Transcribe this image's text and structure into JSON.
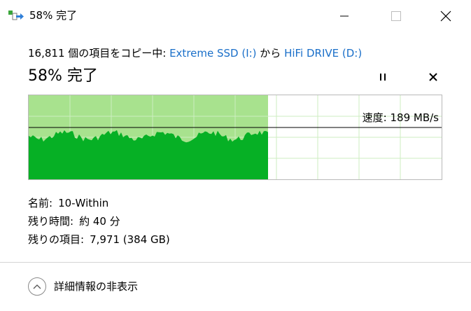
{
  "window": {
    "title": "58% 完了",
    "icon": "copy-transfer-icon"
  },
  "header": {
    "copy_prefix": "16,811 個の項目をコピー中: ",
    "source": "Extreme SSD (I:)",
    "middle": " から ",
    "destination": "HiFi DRIVE (D:)",
    "percent_title": "58% 完了"
  },
  "controls": {
    "pause_icon": "pause-icon",
    "cancel_icon": "close-icon"
  },
  "progress": {
    "fraction": 0.58
  },
  "speed": {
    "label": "速度: 189 MB/s"
  },
  "details": {
    "name_label": "名前:",
    "name_value": "10-Within",
    "time_label": "残り時間:",
    "time_value": "約 40 分",
    "items_label": "残りの項目:",
    "items_value": "7,971 (384 GB)"
  },
  "footer": {
    "toggle_label": "詳細情報の非表示",
    "toggle_icon": "chevron-up-icon"
  },
  "colors": {
    "progress_fill": "#a8e28e",
    "speed_fill": "#06b025",
    "link": "#1a6fc9",
    "grid": "#cdeec0"
  }
}
